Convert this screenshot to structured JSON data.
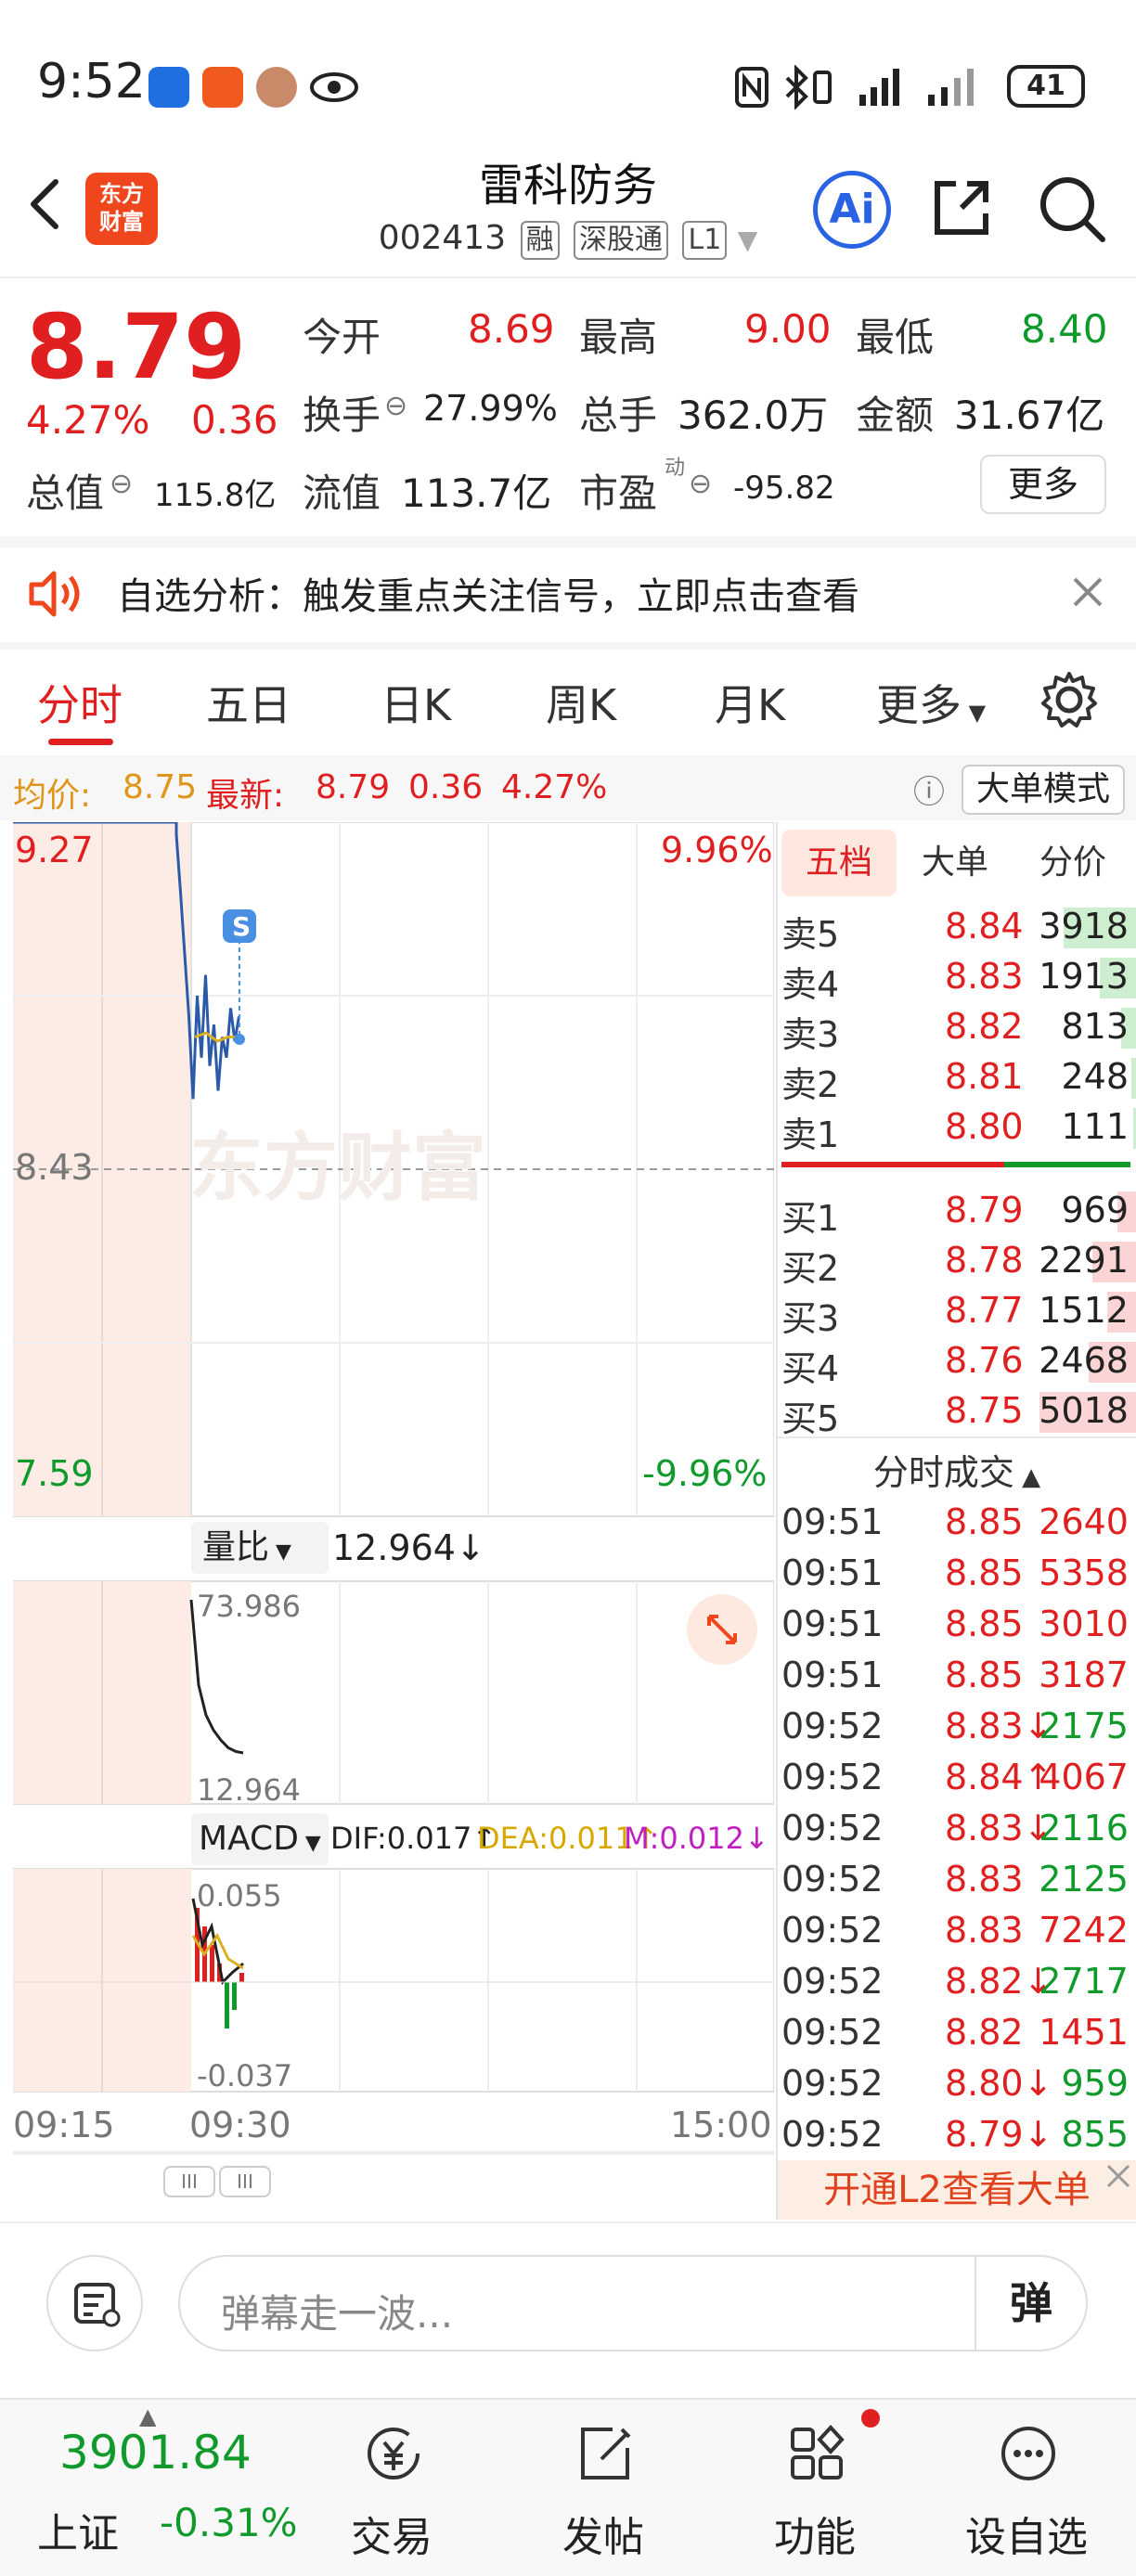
{
  "status_bar": {
    "time": "9:52",
    "battery": "41"
  },
  "header": {
    "logo_line1": "东方",
    "logo_line2": "财富",
    "title": "雷科防务",
    "code": "002413",
    "tags": [
      "融",
      "深股通",
      "L1"
    ]
  },
  "quote": {
    "price": "8.79",
    "change_pct": "4.27%",
    "change": "0.36",
    "open_label": "今开",
    "open": "8.69",
    "high_label": "最高",
    "high": "9.00",
    "low_label": "最低",
    "low": "8.40",
    "turnover_label": "换手",
    "turnover": "27.99%",
    "volume_label": "总手",
    "volume": "362.0万",
    "amount_label": "金额",
    "amount": "31.67亿",
    "mktcap_label": "总值",
    "mktcap": "115.8亿",
    "float_label": "流值",
    "float": "113.7亿",
    "pe_label": "市盈",
    "pe_sup": "动",
    "pe": "-95.82",
    "more_label": "更多"
  },
  "alert": {
    "text": "自选分析：触发重点关注信号，立即点击查看"
  },
  "tabs": [
    "分时",
    "五日",
    "日K",
    "周K",
    "月K",
    "更多"
  ],
  "avg_line": {
    "avg_label": "均价:",
    "avg": "8.75",
    "latest_label": "最新:",
    "latest": "8.79",
    "chg": "0.36",
    "pct": "4.27%",
    "big_order_btn": "大单模式"
  },
  "chart": {
    "top_price": "9.27",
    "mid_price": "8.43",
    "bottom_price": "7.59",
    "top_pct": "9.96%",
    "bottom_pct": "-9.96%",
    "marker": "S",
    "vol_ratio_label": "量比",
    "vol_ratio": "12.964↓",
    "vol_top": "73.986",
    "vol_bottom": "12.964",
    "macd_label": "MACD",
    "dif": "DIF:0.017↑",
    "dea": "DEA:0.011↑",
    "m": "M:0.012↓",
    "macd_top": "0.055",
    "macd_bottom": "-0.037",
    "time_start": "09:15",
    "time_mid": "09:30",
    "time_end": "15:00",
    "watermark": "东方财富",
    "price_series": [
      9.27,
      9.27,
      9.27,
      9.24,
      9.1,
      8.95,
      8.8,
      8.6,
      8.85,
      8.7,
      8.9,
      8.68,
      8.78,
      8.62,
      8.75,
      8.7,
      8.82,
      8.74,
      8.8
    ],
    "avg_series": [
      8.75,
      8.76,
      8.74,
      8.75,
      8.75
    ],
    "vol_series": [
      73.986,
      40,
      28,
      22,
      18,
      15,
      13.5,
      12.964
    ]
  },
  "orderbook": {
    "tabs": [
      "五档",
      "大单",
      "分价"
    ],
    "asks": [
      {
        "name": "卖5",
        "price": "8.84",
        "vol": "3918",
        "level": 0.6
      },
      {
        "name": "卖4",
        "price": "8.83",
        "vol": "1913",
        "level": 0.3
      },
      {
        "name": "卖3",
        "price": "8.82",
        "vol": "813",
        "level": 0.12
      },
      {
        "name": "卖2",
        "price": "8.81",
        "vol": "248",
        "level": 0.04
      },
      {
        "name": "卖1",
        "price": "8.80",
        "vol": "111",
        "level": 0.02
      }
    ],
    "bids": [
      {
        "name": "买1",
        "price": "8.79",
        "vol": "969",
        "level": 0.15
      },
      {
        "name": "买2",
        "price": "8.78",
        "vol": "2291",
        "level": 0.36
      },
      {
        "name": "买3",
        "price": "8.77",
        "vol": "1512",
        "level": 0.24
      },
      {
        "name": "买4",
        "price": "8.76",
        "vol": "2468",
        "level": 0.39
      },
      {
        "name": "买5",
        "price": "8.75",
        "vol": "5018",
        "level": 0.8
      }
    ],
    "trades_title": "分时成交",
    "trades": [
      {
        "t": "09:51",
        "p": "8.85",
        "v": "2640",
        "c": "red"
      },
      {
        "t": "09:51",
        "p": "8.85",
        "v": "5358",
        "c": "red"
      },
      {
        "t": "09:51",
        "p": "8.85",
        "v": "3010",
        "c": "red"
      },
      {
        "t": "09:51",
        "p": "8.85",
        "v": "3187",
        "c": "red"
      },
      {
        "t": "09:52",
        "p": "8.83↓",
        "v": "2175",
        "c": "green"
      },
      {
        "t": "09:52",
        "p": "8.84↑",
        "v": "4067",
        "c": "red"
      },
      {
        "t": "09:52",
        "p": "8.83↓",
        "v": "2116",
        "c": "green"
      },
      {
        "t": "09:52",
        "p": "8.83",
        "v": "2125",
        "c": "green"
      },
      {
        "t": "09:52",
        "p": "8.83",
        "v": "7242",
        "c": "red"
      },
      {
        "t": "09:52",
        "p": "8.82↓",
        "v": "2717",
        "c": "green"
      },
      {
        "t": "09:52",
        "p": "8.82",
        "v": "1451",
        "c": "red"
      },
      {
        "t": "09:52",
        "p": "8.80↓",
        "v": "959",
        "c": "green"
      },
      {
        "t": "09:52",
        "p": "8.79↓",
        "v": "855",
        "c": "green"
      }
    ],
    "l2_banner": "开通L2查看大单"
  },
  "comment": {
    "placeholder": "弹幕走一波...",
    "send_icon_text": "弹"
  },
  "bottom_nav": {
    "index_value": "3901.84",
    "index_name": "上证",
    "index_change": "-0.31%",
    "items": [
      "交易",
      "发帖",
      "功能",
      "设自选"
    ]
  },
  "colors": {
    "up": "#e02020",
    "down": "#109a2c",
    "brand": "#f0461e",
    "ai": "#2a62e4"
  }
}
